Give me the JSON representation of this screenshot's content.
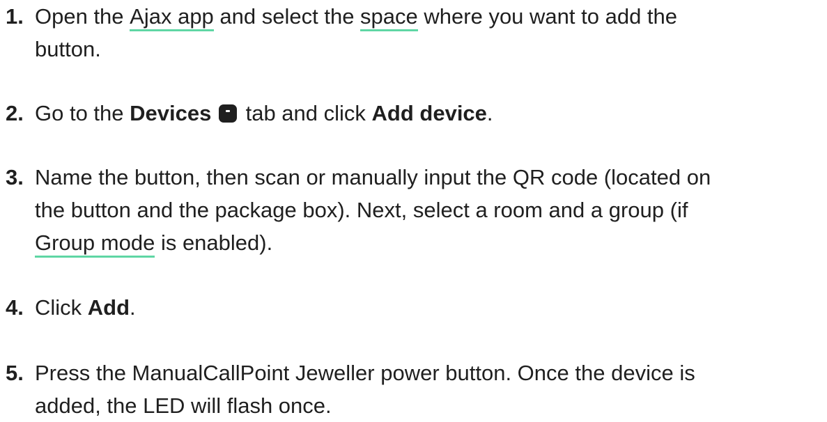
{
  "steps": [
    {
      "num": "1.",
      "pre": "Open the ",
      "link1": "Ajax app",
      "mid": " and select the ",
      "link2": "space",
      "post": " where you want to add the",
      "line2": "button."
    },
    {
      "num": "2.",
      "pre": "Go to the ",
      "bold1": "Devices",
      "mid": " tab and click ",
      "bold2": "Add device",
      "post": "."
    },
    {
      "num": "3.",
      "line1": "Name the button, then scan or manually input the QR code (located on",
      "line2": "the button and the package box). Next, select a room and a group (if",
      "link": "Group mode",
      "line3_post": " is enabled)."
    },
    {
      "num": "4.",
      "pre": "Click ",
      "bold": "Add",
      "post": "."
    },
    {
      "num": "5.",
      "line1": "Press the ManualCallPoint Jeweller power button. Once the device is",
      "line2": "added, the LED will flash once."
    }
  ],
  "colors": {
    "text": "#1f1f1f",
    "link_underline": "#5fd6a4",
    "background": "#ffffff"
  },
  "icons": {
    "devices_tab": "devices-icon"
  }
}
